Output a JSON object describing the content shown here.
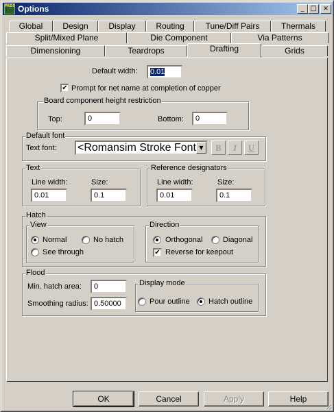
{
  "window": {
    "title": "Options",
    "app_icon_text": "PADS",
    "minimize": "_",
    "maximize": "□",
    "close": "×"
  },
  "tabs": {
    "row1": [
      "Global",
      "Design",
      "Display",
      "Routing",
      "Tune/Diff Pairs",
      "Thermals"
    ],
    "row2": [
      "Split/Mixed Plane",
      "Die Component",
      "Via Patterns"
    ],
    "row3": [
      "Dimensioning",
      "Teardrops",
      "Drafting",
      "Grids"
    ],
    "active": "Drafting"
  },
  "drafting": {
    "default_width_label": "Default width:",
    "default_width_value": "0.01",
    "prompt_net_name_label": "Prompt for net name at completion of copper",
    "prompt_net_name_checked": true,
    "board_height": {
      "title": "Board component height restriction",
      "top_label": "Top:",
      "top_value": "0",
      "bottom_label": "Bottom:",
      "bottom_value": "0"
    },
    "default_font": {
      "title": "Default font",
      "text_font_label": "Text font:",
      "text_font_value": "<Romansim Stroke Font>",
      "bold": "B",
      "italic": "I",
      "underline": "U"
    },
    "text": {
      "title": "Text",
      "line_width_label": "Line width:",
      "line_width_value": "0.01",
      "size_label": "Size:",
      "size_value": "0.1"
    },
    "ref_des": {
      "title": "Reference designators",
      "line_width_label": "Line width:",
      "line_width_value": "0.01",
      "size_label": "Size:",
      "size_value": "0.1"
    },
    "hatch": {
      "title": "Hatch",
      "view": {
        "title": "View",
        "normal": "Normal",
        "no_hatch": "No hatch",
        "see_through": "See through",
        "selected": "Normal"
      },
      "direction": {
        "title": "Direction",
        "orthogonal": "Orthogonal",
        "diagonal": "Diagonal",
        "selected": "Orthogonal"
      },
      "reverse_keepout_label": "Reverse for keepout",
      "reverse_keepout_checked": true
    },
    "flood": {
      "title": "Flood",
      "min_hatch_area_label": "Min. hatch area:",
      "min_hatch_area_value": "0",
      "smoothing_radius_label": "Smoothing radius:",
      "smoothing_radius_value": "0.50000",
      "display_mode": {
        "title": "Display mode",
        "pour_outline": "Pour outline",
        "hatch_outline": "Hatch outline",
        "selected": "Hatch outline"
      }
    }
  },
  "buttons": {
    "ok": "OK",
    "cancel": "Cancel",
    "apply": "Apply",
    "help": "Help"
  }
}
